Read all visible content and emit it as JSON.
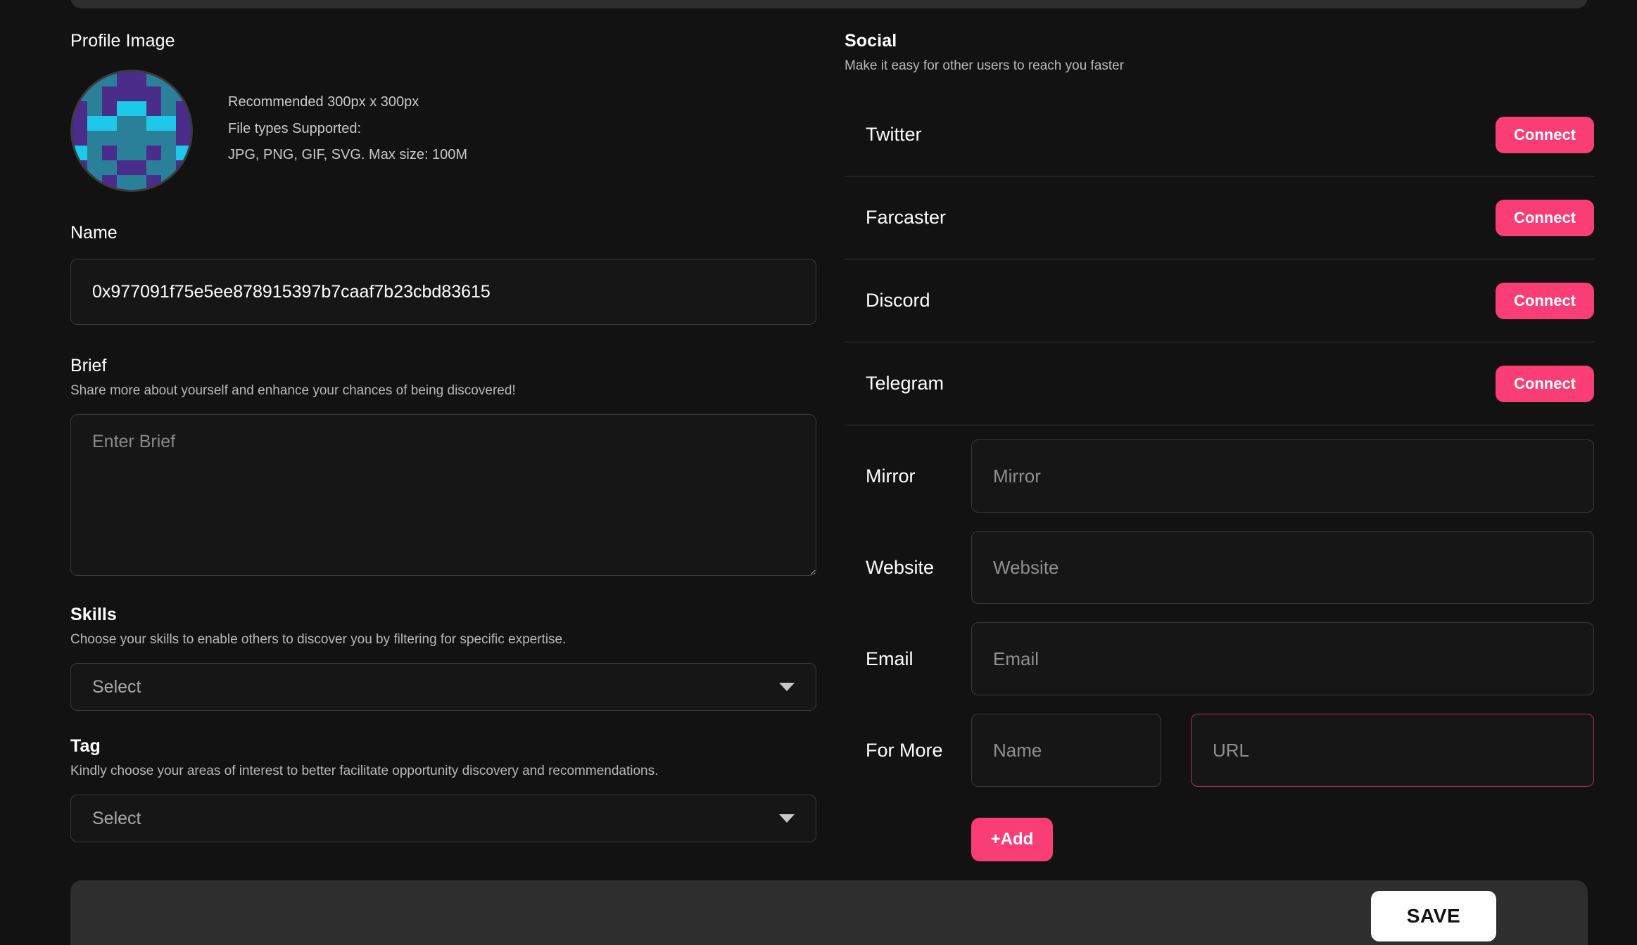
{
  "profile": {
    "image_label": "Profile Image",
    "image_hint": "Recommended 300px x 300px\nFile types Supported:\nJPG, PNG, GIF, SVG. Max size: 100M",
    "avatar_colors": {
      "background": "#4a2d8a",
      "primary": "#2b8099",
      "accent": "#1ec8e8",
      "ring": "#3b3b3b"
    }
  },
  "name": {
    "label": "Name",
    "value": "0x977091f75e5ee878915397b7caaf7b23cbd83615",
    "placeholder": "Name"
  },
  "brief": {
    "label": "Brief",
    "description": "Share more about yourself and enhance your chances of being discovered!",
    "value": "",
    "placeholder": "Enter Brief"
  },
  "skills": {
    "label": "Skills",
    "description": "Choose your skills to enable others to discover you by filtering for specific expertise.",
    "selected": "Select",
    "caret_icon": "chevron-down-icon"
  },
  "tag": {
    "label": "Tag",
    "description": "Kindly choose your areas of interest to better facilitate opportunity discovery and recommendations.",
    "selected": "Select",
    "caret_icon": "chevron-down-icon"
  },
  "social": {
    "title": "Social",
    "description": "Make it easy for other users to reach you faster",
    "accounts": [
      {
        "name": "Twitter",
        "action": "Connect"
      },
      {
        "name": "Farcaster",
        "action": "Connect"
      },
      {
        "name": "Discord",
        "action": "Connect"
      },
      {
        "name": "Telegram",
        "action": "Connect"
      }
    ],
    "links": [
      {
        "name": "Mirror",
        "placeholder": "Mirror",
        "value": ""
      },
      {
        "name": "Website",
        "placeholder": "Website",
        "value": ""
      },
      {
        "name": "Email",
        "placeholder": "Email",
        "value": ""
      }
    ],
    "for_more": {
      "label": "For More",
      "name_placeholder": "Name",
      "name_value": "",
      "url_placeholder": "URL",
      "url_value": "",
      "url_state": "error-focused",
      "add_label": "+Add"
    }
  },
  "footer": {
    "save_label": "SAVE"
  },
  "colors": {
    "accent_pink": "#fa3d74",
    "error_border": "#b03050",
    "page_background": "#121212",
    "field_background": "#161616",
    "field_border": "#3a3a3a",
    "bar_background": "#2e2e2e"
  }
}
